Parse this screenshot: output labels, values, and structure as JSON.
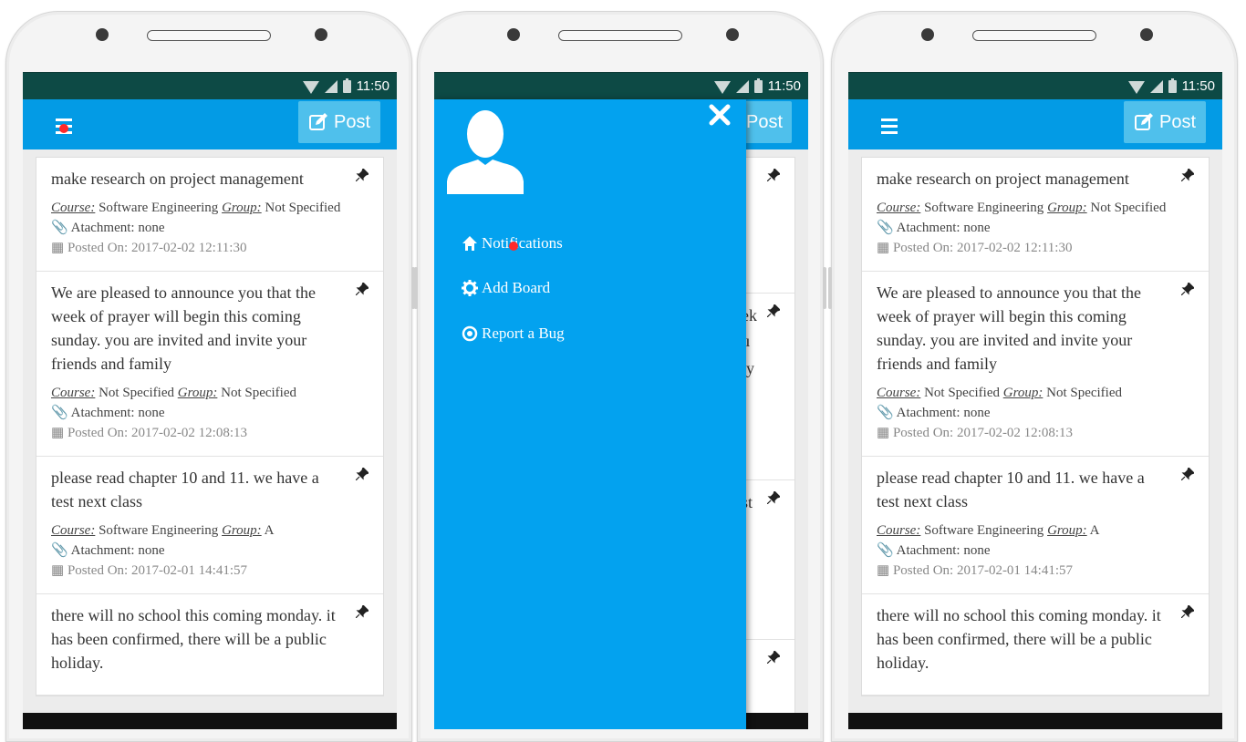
{
  "status": {
    "time": "11:50"
  },
  "appbar": {
    "post_label": "Post"
  },
  "posts": [
    {
      "message": "make research on project management",
      "course_label": "Course:",
      "course": "Software Engineering",
      "group_label": "Group:",
      "group": "Not Specified",
      "attachment": "Atachment: none",
      "posted": "Posted On: 2017-02-02 12:11:30"
    },
    {
      "message": "We are pleased to announce you that the week of prayer will begin this coming sunday. you are invited and invite your friends and family",
      "course_label": "Course:",
      "course": "Not Specified",
      "group_label": "Group:",
      "group": "Not Specified",
      "attachment": "Atachment: none",
      "posted": "Posted On: 2017-02-02 12:08:13"
    },
    {
      "message": "please read chapter 10 and 11. we have a test next class",
      "course_label": "Course:",
      "course": "Software Engineering",
      "group_label": "Group:",
      "group": "A",
      "attachment": "Atachment: none",
      "posted": "Posted On: 2017-02-01 14:41:57"
    },
    {
      "message": "there will no school this coming monday. it has been confirmed, there will be a public holiday.",
      "course_label": "",
      "course": "",
      "group_label": "",
      "group": "",
      "attachment": "",
      "posted": ""
    }
  ],
  "drawer": {
    "items": [
      {
        "label": "Notifications",
        "icon": "home-icon"
      },
      {
        "label": "Add Board",
        "icon": "gear-icon"
      },
      {
        "label": "Report a Bug",
        "icon": "target-icon"
      }
    ]
  },
  "peek_text": [
    "ek",
    "u",
    "ly",
    "st"
  ],
  "colors": {
    "appbar": "#039be5",
    "statusbar": "#0d4a45",
    "drawer": "#03a2ef",
    "post_button": "#4fc0ec",
    "tap_marker": "#ff2a2a"
  }
}
